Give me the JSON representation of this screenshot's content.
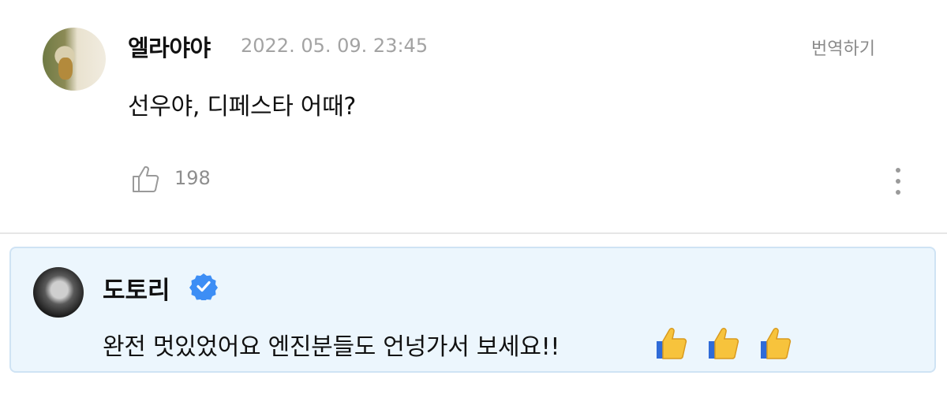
{
  "post": {
    "username": "엘라야야",
    "date": "2022. 05. 09. 23:45",
    "translate_label": "번역하기",
    "comment": "선우야, 디페스타 어때?",
    "like_count": "198"
  },
  "reply": {
    "username": "도토리",
    "comment": "완전 멋있었어요 엔진분들도 언넝가서 보세요!!",
    "emoji_count": 3
  },
  "icons": {
    "like": "thumbs-up-outline-icon",
    "more": "vertical-ellipsis-icon",
    "verified": "verified-badge-icon",
    "emoji": "thumbs-up-emoji"
  },
  "colors": {
    "reply_background": "#ecf6fd",
    "reply_border": "#cfe3f4",
    "verified_badge": "#3d8ef5",
    "emoji_yellow": "#f7c33c"
  }
}
